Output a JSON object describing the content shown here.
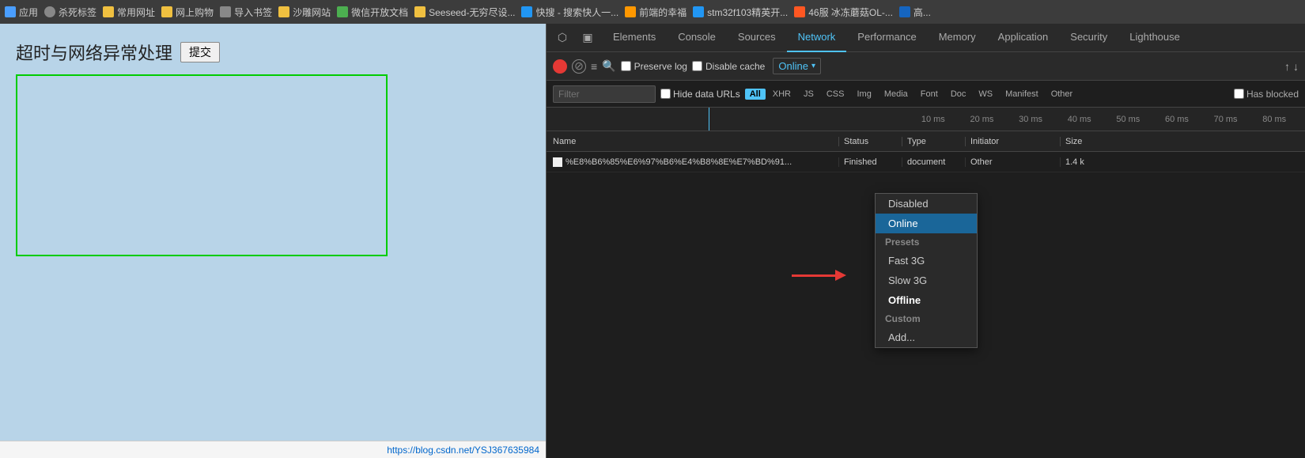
{
  "bookmarks": {
    "items": [
      {
        "icon": "apps",
        "label": "应用"
      },
      {
        "icon": "skull",
        "label": "杀死标签"
      },
      {
        "icon": "bookmark",
        "label": "常用网址"
      },
      {
        "icon": "bookmark",
        "label": "网上购物"
      },
      {
        "icon": "gear",
        "label": "导入书签"
      },
      {
        "icon": "bookmark",
        "label": "沙雕网站"
      },
      {
        "icon": "wechat",
        "label": "微信开放文档"
      },
      {
        "icon": "seed",
        "label": "Seeseed-无穷尽设..."
      },
      {
        "icon": "search",
        "label": "快搜 - 搜索快人一..."
      },
      {
        "icon": "star",
        "label": "前端的幸福"
      },
      {
        "icon": "chip",
        "label": "stm32f103精英开..."
      },
      {
        "icon": "game",
        "label": "46服 冰冻蘑菇OL-..."
      },
      {
        "icon": "store",
        "label": "高..."
      }
    ]
  },
  "page": {
    "title": "超时与网络异常处理",
    "submit_label": "提交"
  },
  "devtools": {
    "tabs": [
      {
        "label": "Elements",
        "active": false
      },
      {
        "label": "Console",
        "active": false
      },
      {
        "label": "Sources",
        "active": false
      },
      {
        "label": "Network",
        "active": true
      },
      {
        "label": "Performance",
        "active": false
      },
      {
        "label": "Memory",
        "active": false
      },
      {
        "label": "Application",
        "active": false
      },
      {
        "label": "Security",
        "active": false
      },
      {
        "label": "Lighthouse",
        "active": false
      }
    ],
    "toolbar": {
      "preserve_log_label": "Preserve log",
      "disable_cache_label": "Disable cache",
      "throttle_label": "Online",
      "online_label": "Online"
    },
    "filter": {
      "placeholder": "Filter",
      "hide_data_urls": "Hide data URLs",
      "all_label": "All",
      "types": [
        "XHR",
        "JS",
        "CSS",
        "Img",
        "Media",
        "Font",
        "Doc",
        "WS",
        "Manifest",
        "Other"
      ],
      "has_blocked_label": "Has blocked"
    },
    "timeline": {
      "ticks": [
        "10 ms",
        "20 ms",
        "30 ms",
        "40 ms",
        "50 ms",
        "60 ms",
        "70 ms",
        "80 ms"
      ]
    },
    "table": {
      "columns": [
        "Name",
        "Status",
        "Type",
        "Initiator",
        "Size"
      ],
      "rows": [
        {
          "name": "%E8%B6%85%E6%97%B6%E4%B8%8E%E7%BD%91...",
          "status": "Finished",
          "type": "document",
          "initiator": "Other",
          "size": "1.4 k"
        }
      ]
    },
    "dropdown": {
      "disabled_label": "Disabled",
      "online_label": "Online",
      "presets_label": "Presets",
      "fast3g_label": "Fast 3G",
      "slow3g_label": "Slow 3G",
      "offline_label": "Offline",
      "custom_label": "Custom",
      "add_label": "Add..."
    }
  },
  "status_bar": {
    "url": "https://blog.csdn.net/YSJ367635984"
  }
}
